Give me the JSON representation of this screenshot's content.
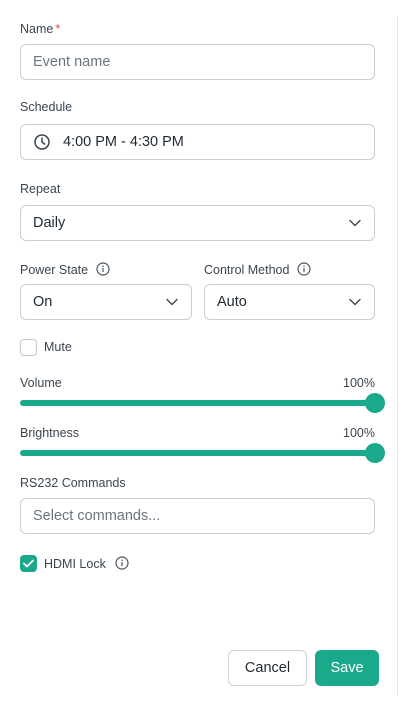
{
  "form": {
    "name": {
      "label": "Name",
      "required_mark": "*",
      "placeholder": "Event name",
      "value": ""
    },
    "schedule": {
      "label": "Schedule",
      "value": "4:00 PM - 4:30 PM",
      "icon": "clock-icon"
    },
    "repeat": {
      "label": "Repeat",
      "value": "Daily"
    },
    "power_state": {
      "label": "Power State",
      "value": "On"
    },
    "control_method": {
      "label": "Control Method",
      "value": "Auto"
    },
    "mute": {
      "label": "Mute",
      "checked": false
    },
    "volume": {
      "label": "Volume",
      "value_text": "100%",
      "value": 100
    },
    "brightness": {
      "label": "Brightness",
      "value_text": "100%",
      "value": 100
    },
    "rs232": {
      "label": "RS232 Commands",
      "placeholder": "Select commands..."
    },
    "hdmi_lock": {
      "label": "HDMI Lock",
      "checked": true
    }
  },
  "actions": {
    "cancel_label": "Cancel",
    "save_label": "Save"
  },
  "colors": {
    "accent": "#1aa98b",
    "required": "#e5484d",
    "border": "#c9ced4"
  }
}
